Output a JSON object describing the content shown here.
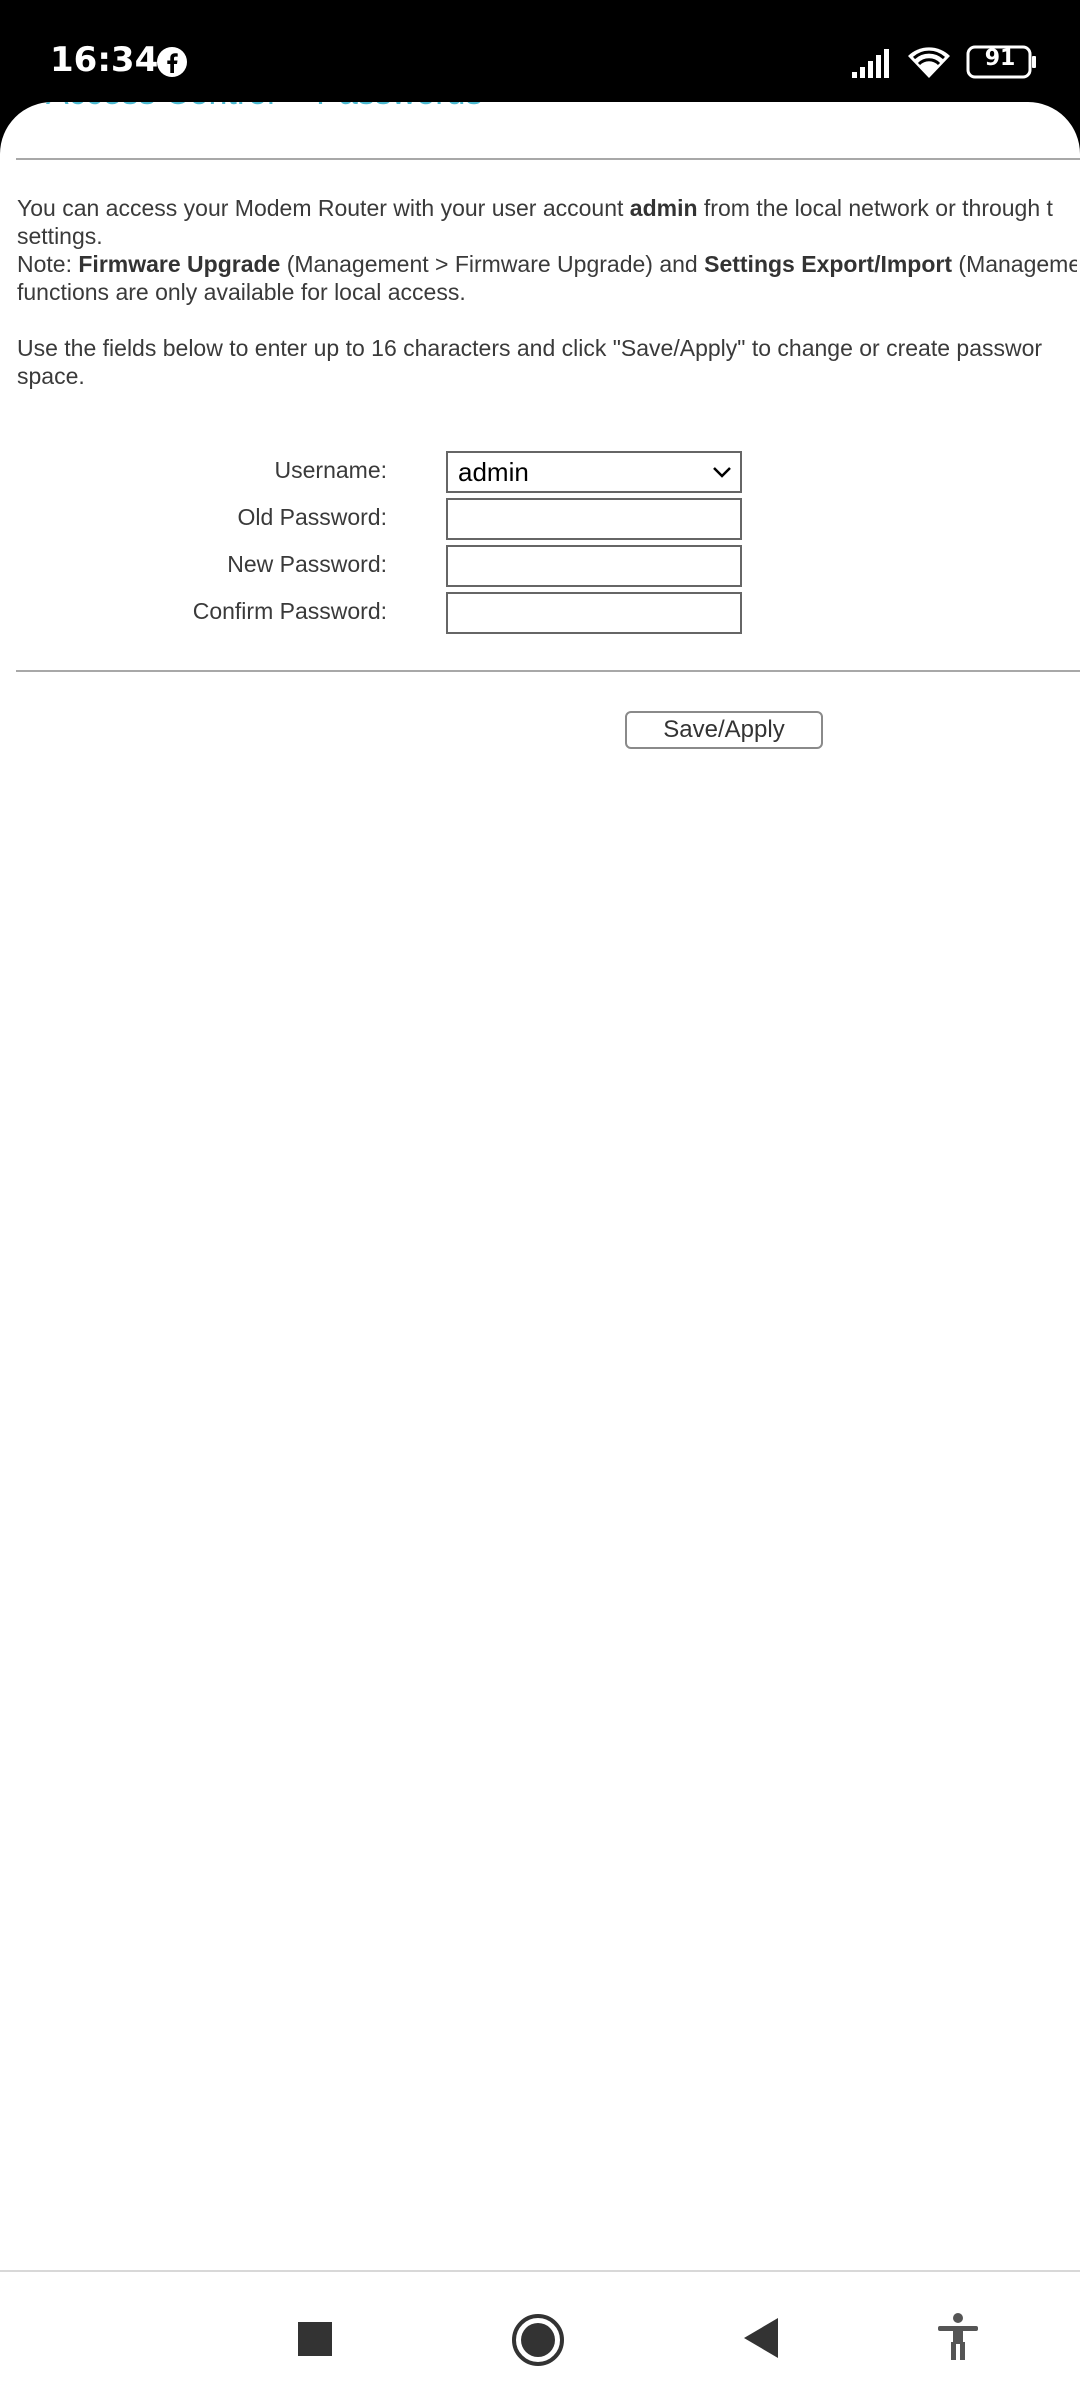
{
  "status_bar": {
    "time": "16:34",
    "battery": "91",
    "icons": [
      "facebook-icon",
      "signal-icon",
      "wifi-icon",
      "battery-icon"
    ]
  },
  "page": {
    "title": "Access Control -- Passwords",
    "para1": {
      "line1_a": "You can access your Modem Router with your user account ",
      "line1_b": "admin",
      "line1_c": " from the local network or through t",
      "line2": "settings.",
      "line3_a": "Note: ",
      "line3_b": "Firmware Upgrade",
      "line3_c": " (Management > Firmware Upgrade) and ",
      "line3_d": "Settings Export/Import",
      "line3_e": " (Manageme",
      "line4": "functions are only available for local access."
    },
    "para2": {
      "line1": "Use the fields below to enter up to 16 characters and click \"Save/Apply\" to change or create passwor",
      "line2": "space."
    }
  },
  "form": {
    "username_label": "Username:",
    "username_value": "admin",
    "old_password_label": "Old Password:",
    "new_password_label": "New Password:",
    "confirm_password_label": "Confirm Password:",
    "save_label": "Save/Apply"
  },
  "nav_bar": {
    "icons": [
      "recents-square-icon",
      "home-circle-icon",
      "back-triangle-icon",
      "accessibility-icon"
    ]
  }
}
